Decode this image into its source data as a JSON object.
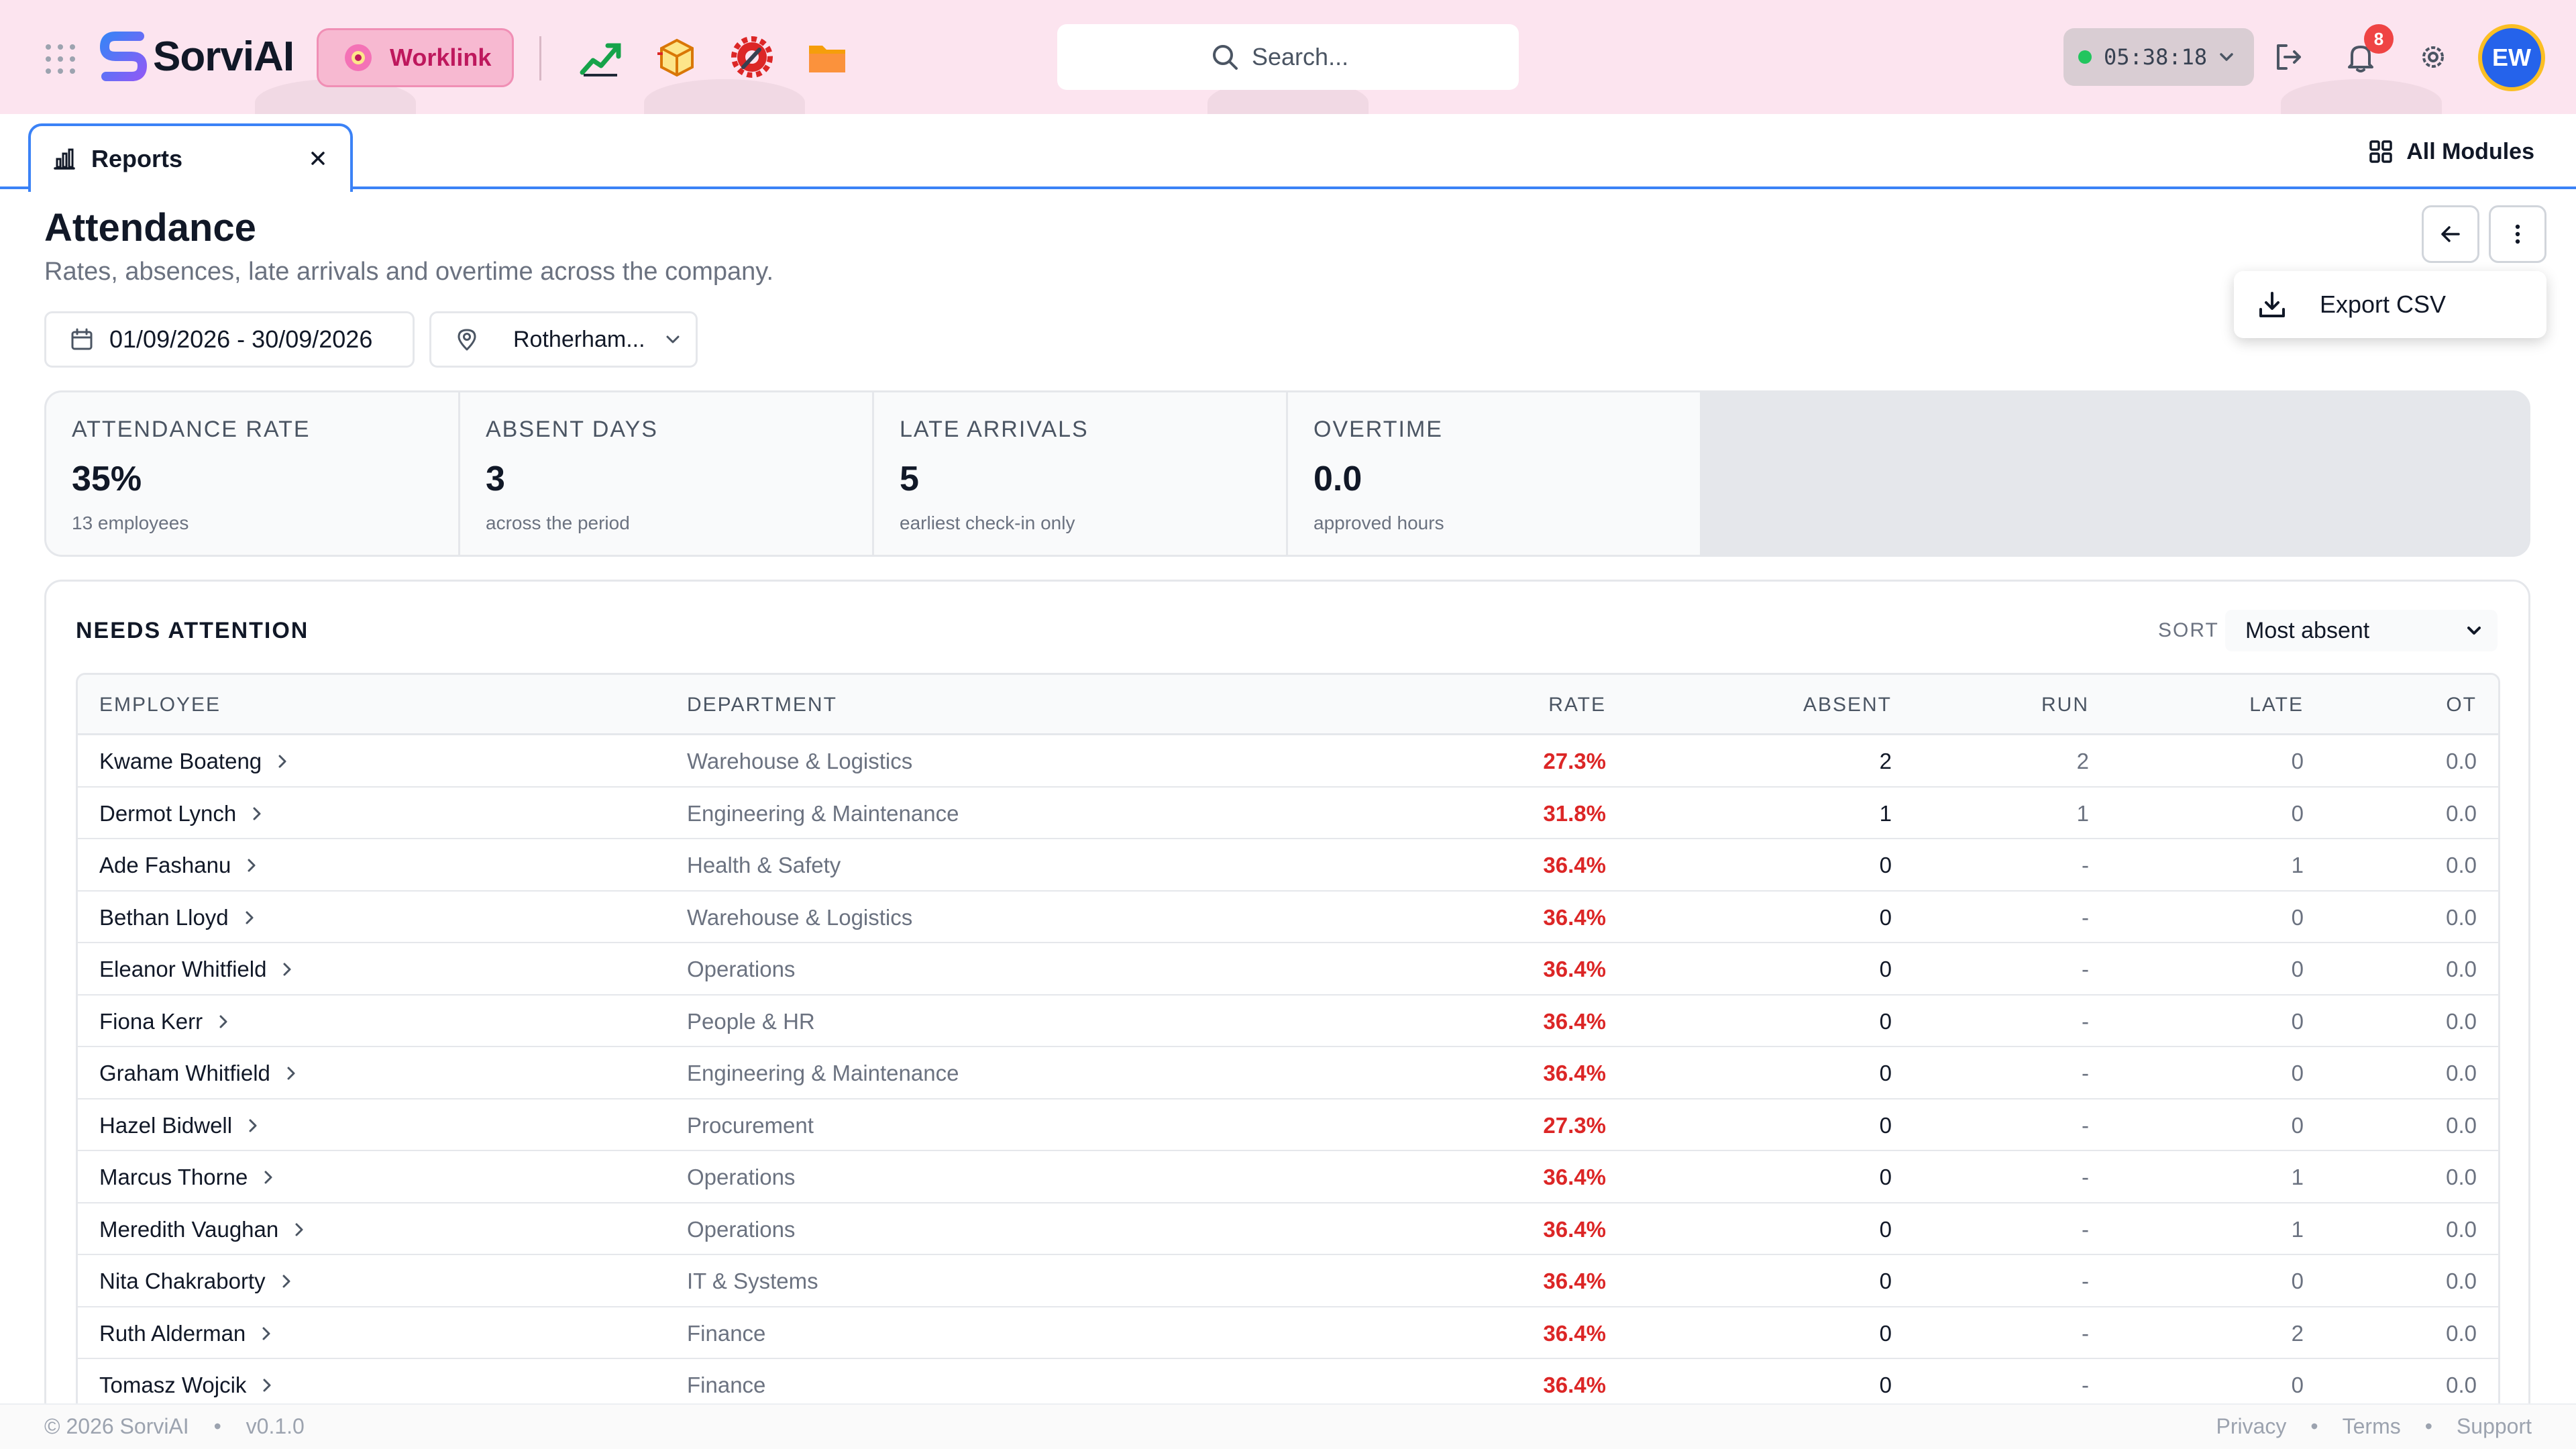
{
  "app": {
    "name": "SorviAI",
    "workspace_label": "Worklink",
    "search_placeholder": "Search...",
    "timer": "05:38:18",
    "notification_count": "8",
    "user_initials": "EW",
    "brand_colors": {
      "accent": "#3b82f6",
      "worklink": "#be185d",
      "alert": "#dc2626",
      "online": "#22c55e"
    },
    "module_icons": [
      "chart-trend-icon",
      "package-icon",
      "gear-wrench-icon",
      "folder-icon"
    ]
  },
  "tabs": {
    "active_label": "Reports",
    "all_modules_label": "All Modules"
  },
  "header": {
    "title": "Attendance",
    "subtitle": "Rates, absences, late arrivals and overtime across the company.",
    "date_range": "01/09/2026 - 30/09/2026",
    "location": "Rotherham...",
    "menu_export_label": "Export CSV"
  },
  "kpis": [
    {
      "label": "ATTENDANCE RATE",
      "value": "35%",
      "sub": "13 employees"
    },
    {
      "label": "ABSENT DAYS",
      "value": "3",
      "sub": "across the period"
    },
    {
      "label": "LATE ARRIVALS",
      "value": "5",
      "sub": "earliest check-in only"
    },
    {
      "label": "OVERTIME",
      "value": "0.0",
      "sub": "approved hours"
    }
  ],
  "attention": {
    "title": "NEEDS ATTENTION",
    "sort_label": "SORT",
    "sort_value": "Most absent",
    "columns": [
      "EMPLOYEE",
      "DEPARTMENT",
      "RATE",
      "ABSENT",
      "RUN",
      "LATE",
      "OT"
    ],
    "rows": [
      {
        "name": "Kwame Boateng",
        "dept": "Warehouse & Logistics",
        "rate": "27.3%",
        "absent": "2",
        "run": "2",
        "late": "0",
        "ot": "0.0"
      },
      {
        "name": "Dermot Lynch",
        "dept": "Engineering & Maintenance",
        "rate": "31.8%",
        "absent": "1",
        "run": "1",
        "late": "0",
        "ot": "0.0"
      },
      {
        "name": "Ade Fashanu",
        "dept": "Health & Safety",
        "rate": "36.4%",
        "absent": "0",
        "run": "-",
        "late": "1",
        "ot": "0.0"
      },
      {
        "name": "Bethan Lloyd",
        "dept": "Warehouse & Logistics",
        "rate": "36.4%",
        "absent": "0",
        "run": "-",
        "late": "0",
        "ot": "0.0"
      },
      {
        "name": "Eleanor Whitfield",
        "dept": "Operations",
        "rate": "36.4%",
        "absent": "0",
        "run": "-",
        "late": "0",
        "ot": "0.0"
      },
      {
        "name": "Fiona Kerr",
        "dept": "People & HR",
        "rate": "36.4%",
        "absent": "0",
        "run": "-",
        "late": "0",
        "ot": "0.0"
      },
      {
        "name": "Graham Whitfield",
        "dept": "Engineering & Maintenance",
        "rate": "36.4%",
        "absent": "0",
        "run": "-",
        "late": "0",
        "ot": "0.0"
      },
      {
        "name": "Hazel Bidwell",
        "dept": "Procurement",
        "rate": "27.3%",
        "absent": "0",
        "run": "-",
        "late": "0",
        "ot": "0.0"
      },
      {
        "name": "Marcus Thorne",
        "dept": "Operations",
        "rate": "36.4%",
        "absent": "0",
        "run": "-",
        "late": "1",
        "ot": "0.0"
      },
      {
        "name": "Meredith Vaughan",
        "dept": "Operations",
        "rate": "36.4%",
        "absent": "0",
        "run": "-",
        "late": "1",
        "ot": "0.0"
      },
      {
        "name": "Nita Chakraborty",
        "dept": "IT & Systems",
        "rate": "36.4%",
        "absent": "0",
        "run": "-",
        "late": "0",
        "ot": "0.0"
      },
      {
        "name": "Ruth Alderman",
        "dept": "Finance",
        "rate": "36.4%",
        "absent": "0",
        "run": "-",
        "late": "2",
        "ot": "0.0"
      },
      {
        "name": "Tomasz Wojcik",
        "dept": "Finance",
        "rate": "36.4%",
        "absent": "0",
        "run": "-",
        "late": "0",
        "ot": "0.0"
      }
    ]
  },
  "footer": {
    "copyright": "© 2026 SorviAI",
    "separator": "•",
    "version": "v0.1.0",
    "links": [
      "Privacy",
      "Terms",
      "Support"
    ]
  }
}
